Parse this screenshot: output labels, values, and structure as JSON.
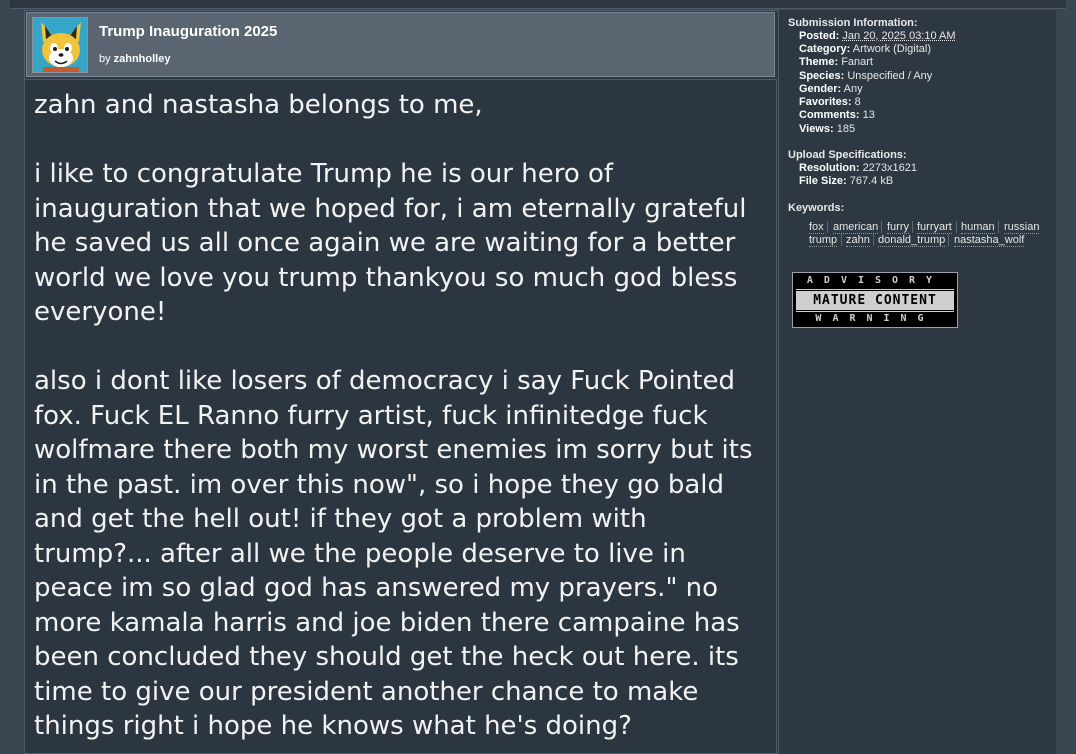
{
  "submission": {
    "title": "Trump Inauguration 2025",
    "by_label": "by",
    "author": "zahnholley",
    "description": [
      "zahn and nastasha belongs to me,",
      "",
      "i like to congratulate Trump he is our hero of inauguration that we hoped for, i am eternally grateful he saved us all once again we are waiting for a better world we love you trump thankyou so much god bless everyone!",
      "",
      "also i dont like losers of democracy i say Fuck Pointed fox. Fuck EL Ranno furry artist, fuck infinitedge fuck wolfmare there both my worst enemies im sorry but its in the past. im over this now\", so i hope they go bald and get the hell out! if they got a problem with trump?... after all we the people deserve to live in peace im so glad god has answered my prayers.\" no more kamala harris and joe biden there campaine has been concluded they should get the heck out here. its time to give our president another chance to make things right i hope he knows what he's doing?"
    ]
  },
  "sidebar": {
    "submission_info_heading": "Submission Information:",
    "info": [
      {
        "key": "Posted:",
        "value": "Jan 20, 2025 03:10 AM"
      },
      {
        "key": "Category:",
        "value": "Artwork (Digital)"
      },
      {
        "key": "Theme:",
        "value": "Fanart"
      },
      {
        "key": "Species:",
        "value": "Unspecified / Any"
      },
      {
        "key": "Gender:",
        "value": "Any"
      },
      {
        "key": "Favorites:",
        "value": "8"
      },
      {
        "key": "Comments:",
        "value": "13"
      },
      {
        "key": "Views:",
        "value": "185"
      }
    ],
    "upload_spec_heading": "Upload Specifications:",
    "specs": [
      {
        "key": "Resolution:",
        "value": "2273x1621"
      },
      {
        "key": "File Size:",
        "value": "767.4 kB"
      }
    ],
    "keywords_heading": "Keywords:",
    "keywords_row1": [
      "fox",
      "american",
      "furry",
      "furryart",
      "human",
      "russian"
    ],
    "keywords_row2": [
      "trump",
      "zahn",
      "donald_trump",
      "nastasha_wolf"
    ],
    "advisory": {
      "top": "ADVISORY",
      "middle": "MATURE CONTENT",
      "bottom": "WARNING"
    }
  },
  "colors": {
    "header_bg": "#5a6571",
    "panel_bg": "#2c3640",
    "text": "#f2f2f2"
  }
}
